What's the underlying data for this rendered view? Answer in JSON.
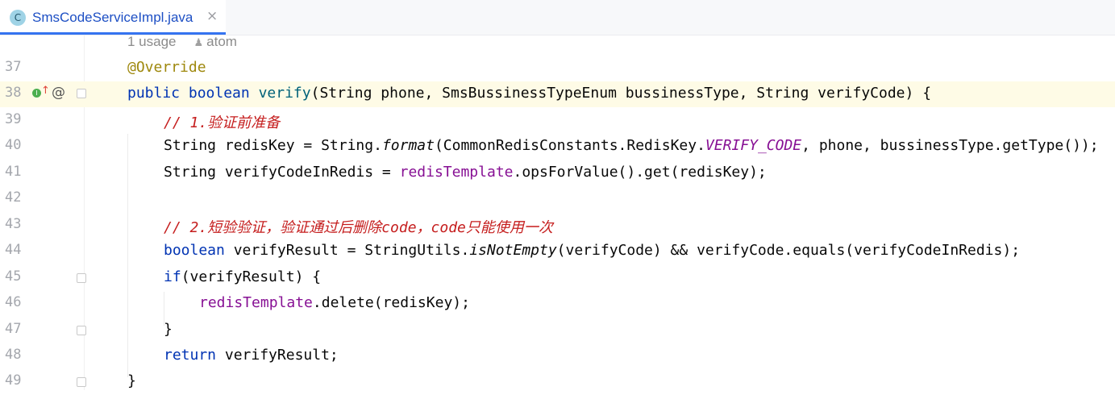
{
  "tab": {
    "icon_letter": "C",
    "title": "SmsCodeServiceImpl.java",
    "close": "×"
  },
  "hint": {
    "usages": "1 usage",
    "author_icon": "person-icon",
    "author": "atom"
  },
  "lines": {
    "l37": {
      "num": "37",
      "annotation": "@Override"
    },
    "l38": {
      "num": "38",
      "kw_public": "public",
      "kw_boolean": "boolean",
      "method": "verify",
      "params": "(String phone, SmsBussinessTypeEnum bussinessType, String verifyCode) {",
      "gutter_at": "@"
    },
    "l39": {
      "num": "39",
      "comment": "// 1.验证前准备"
    },
    "l40": {
      "num": "40",
      "p1": "String redisKey = String.",
      "format": "format",
      "p2": "(CommonRedisConstants.RedisKey.",
      "constant": "VERIFY_CODE",
      "p3": ", phone, bussinessType.getType());"
    },
    "l41": {
      "num": "41",
      "p1": "String verifyCodeInRedis = ",
      "field": "redisTemplate",
      "p2": ".opsForValue().get(redisKey);"
    },
    "l42": {
      "num": "42"
    },
    "l43": {
      "num": "43",
      "comment": "// 2.短验验证，验证通过后删除code，code只能使用一次"
    },
    "l44": {
      "num": "44",
      "kw": "boolean",
      "p1": " verifyResult = StringUtils.",
      "static_call": "isNotEmpty",
      "p2": "(verifyCode) && verifyCode.equals(verifyCodeInRedis);"
    },
    "l45": {
      "num": "45",
      "kw": "if",
      "p1": "(verifyResult) {"
    },
    "l46": {
      "num": "46",
      "field": "redisTemplate",
      "p1": ".delete(redisKey);"
    },
    "l47": {
      "num": "47",
      "brace": "}"
    },
    "l48": {
      "num": "48",
      "kw": "return",
      "p1": " verifyResult;"
    },
    "l49": {
      "num": "49",
      "brace": "}"
    }
  },
  "colors": {
    "keyword": "#0033b3",
    "annotation": "#9e880d",
    "method": "#00627a",
    "field": "#871094",
    "comment": "#c51d1d",
    "current_line": "#fefbe6",
    "tab_accent": "#3574f0"
  }
}
